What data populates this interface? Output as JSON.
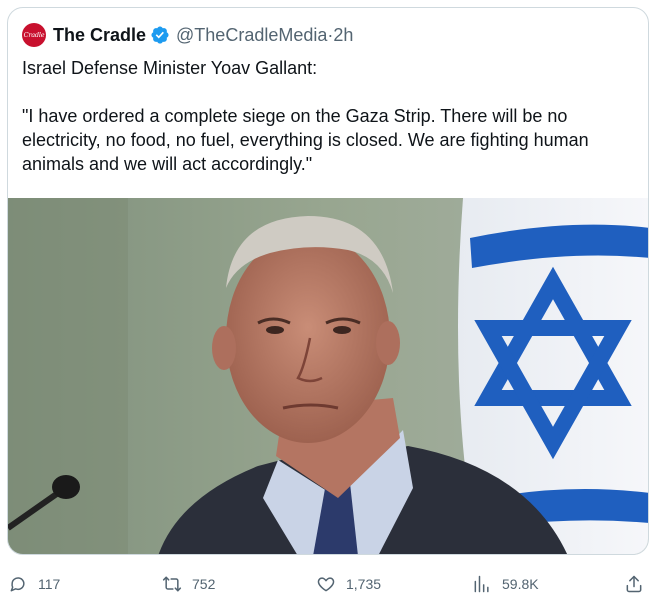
{
  "tweet": {
    "author": {
      "name": "The Cradle",
      "handle": "@TheCradleMedia",
      "avatar_text": "Cradle",
      "verified_icon": "verified-badge-icon"
    },
    "separator": "·",
    "time": "2h",
    "text_line1": "Israel Defense Minister Yoav Gallant:",
    "text_quote": "\"I have ordered a complete siege on the Gaza Strip. There will be no electricity, no food, no fuel, everything is closed. We are fighting human animals and we will act accordingly.\"",
    "media": {
      "description_icon": "photo",
      "colors": {
        "wall": "#8a9a86",
        "flag_blue": "#1f5fbf",
        "suit": "#2b2f3a",
        "shirt": "#c9d3e6",
        "tie": "#2c3a6b"
      }
    }
  },
  "actions": {
    "reply": {
      "count": "117",
      "icon": "reply-icon"
    },
    "retweet": {
      "count": "752",
      "icon": "retweet-icon"
    },
    "like": {
      "count": "1,735",
      "icon": "heart-icon"
    },
    "views": {
      "count": "59.8K",
      "icon": "views-icon"
    },
    "share": {
      "icon": "share-icon"
    }
  },
  "colors": {
    "verified": "#1d9bf0",
    "text": "#0f1419",
    "muted": "#536471",
    "border": "#cfd9de"
  }
}
